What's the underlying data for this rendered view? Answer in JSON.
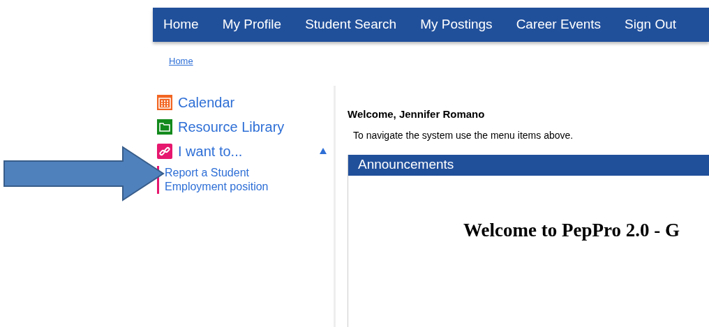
{
  "nav": [
    {
      "label": "Home"
    },
    {
      "label": "My Profile"
    },
    {
      "label": "Student Search"
    },
    {
      "label": "My Postings"
    },
    {
      "label": "Career Events"
    },
    {
      "label": "Sign Out"
    }
  ],
  "breadcrumb": "Home",
  "sidebar": {
    "items": [
      {
        "label": "Calendar",
        "kind": "calendar",
        "color": "#f26522"
      },
      {
        "label": "Resource Library",
        "kind": "folder",
        "color": "#138a1c"
      },
      {
        "label": "I want to...",
        "kind": "link",
        "color": "#e6176e",
        "expanded": true,
        "children": [
          {
            "label": "Report a Student Employment position"
          }
        ]
      }
    ]
  },
  "welcome": {
    "title": "Welcome, Jennifer Romano",
    "text": "To navigate the system use the menu items above."
  },
  "announcements": {
    "title": "Announcements",
    "heading": "Welcome to PepPro 2.0 - G"
  }
}
